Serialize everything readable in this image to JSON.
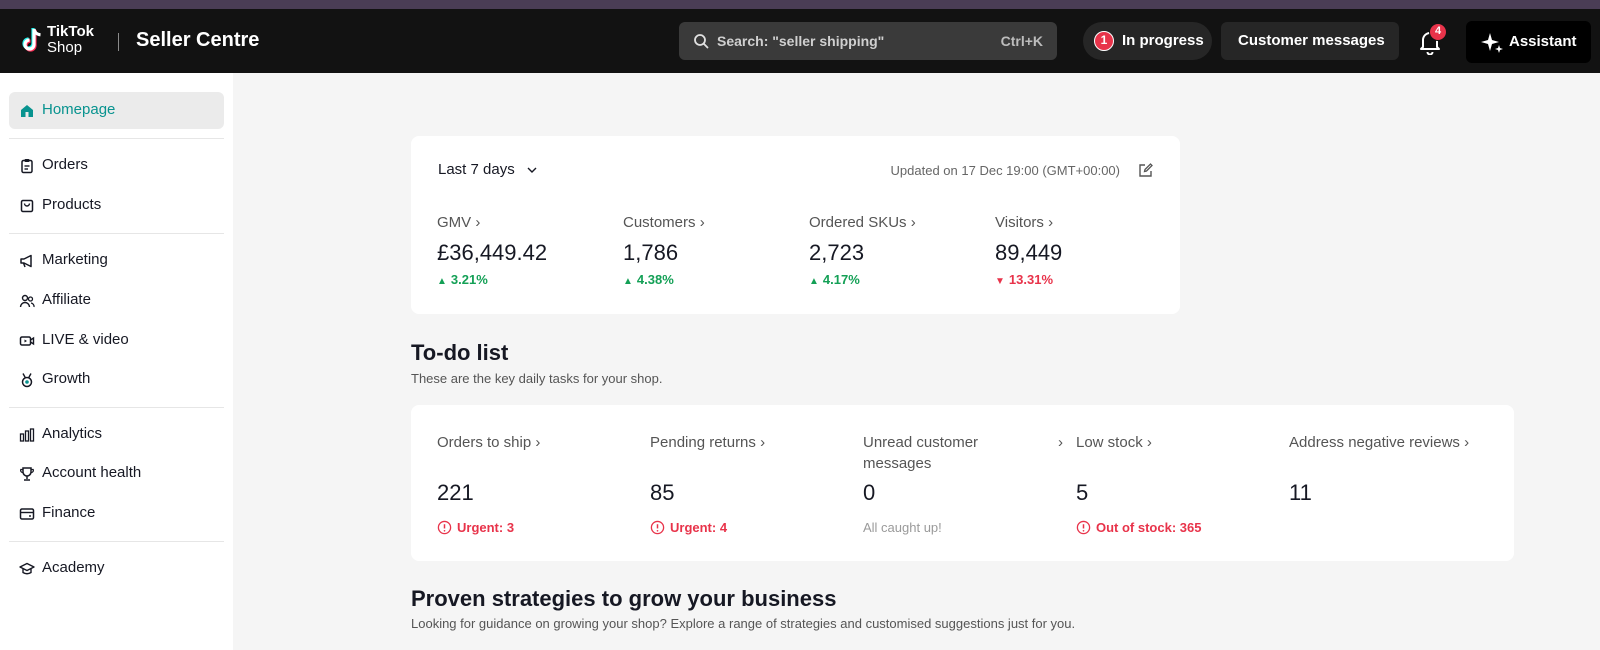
{
  "header": {
    "logo_line1": "TikTok",
    "logo_line2": "Shop",
    "app_title": "Seller Centre",
    "search_placeholder": "Search: \"seller shipping\"",
    "search_shortcut": "Ctrl+K",
    "progress_count": "1",
    "progress_label": "In progress",
    "messages_label": "Customer messages",
    "notification_count": "4",
    "assistant_label": "Assistant"
  },
  "sidebar": {
    "items": [
      {
        "label": "Homepage",
        "icon": "home-icon",
        "active": true
      },
      {
        "label": "Orders",
        "icon": "clipboard-icon"
      },
      {
        "label": "Products",
        "icon": "box-icon"
      },
      {
        "label": "Marketing",
        "icon": "megaphone-icon"
      },
      {
        "label": "Affiliate",
        "icon": "people-icon"
      },
      {
        "label": "LIVE & video",
        "icon": "video-icon"
      },
      {
        "label": "Growth",
        "icon": "medal-icon"
      },
      {
        "label": "Analytics",
        "icon": "bar-chart-icon"
      },
      {
        "label": "Account health",
        "icon": "trophy-icon"
      },
      {
        "label": "Finance",
        "icon": "wallet-icon"
      },
      {
        "label": "Academy",
        "icon": "graduation-cap-icon"
      }
    ]
  },
  "metrics": {
    "range_label": "Last 7 days",
    "updated_text": "Updated on 17 Dec 19:00 (GMT+00:00)",
    "items": [
      {
        "label": "GMV",
        "value": "£36,449.42",
        "change": "3.21%",
        "direction": "up"
      },
      {
        "label": "Customers",
        "value": "1,786",
        "change": "4.38%",
        "direction": "up"
      },
      {
        "label": "Ordered SKUs",
        "value": "2,723",
        "change": "4.17%",
        "direction": "up"
      },
      {
        "label": "Visitors",
        "value": "89,449",
        "change": "13.31%",
        "direction": "down"
      }
    ]
  },
  "todo": {
    "title": "To-do list",
    "subtitle": "These are the key daily tasks for your shop.",
    "tasks": [
      {
        "label": "Orders to ship",
        "value": "221",
        "note": "Urgent: 3",
        "note_type": "urgent"
      },
      {
        "label": "Pending returns",
        "value": "85",
        "note": "Urgent: 4",
        "note_type": "urgent"
      },
      {
        "label": "Unread customer messages",
        "value": "0",
        "note": "All caught up!",
        "note_type": "ok"
      },
      {
        "label": "Low stock",
        "value": "5",
        "note": "Out of stock: 365",
        "note_type": "urgent"
      },
      {
        "label": "Address negative reviews",
        "value": "11",
        "note": "",
        "note_type": "none"
      }
    ]
  },
  "strategies": {
    "title": "Proven strategies to grow your business",
    "subtitle": "Looking for guidance on growing your shop? Explore a range of strategies and customised suggestions just for you."
  },
  "colors": {
    "accent": "#08938f",
    "up": "#14a056",
    "down": "#e8334a",
    "header_bg": "#121212"
  }
}
